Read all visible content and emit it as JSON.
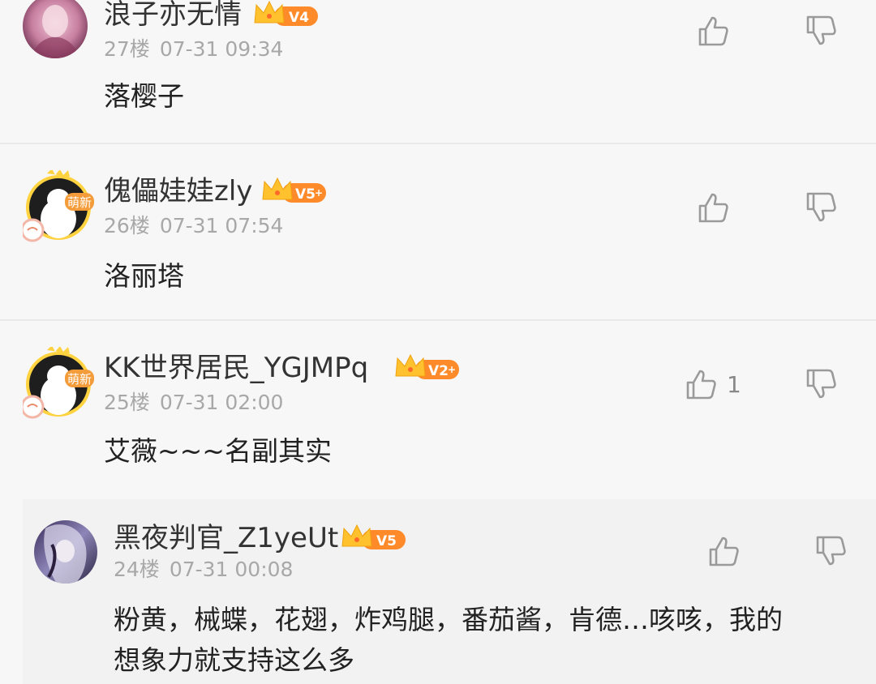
{
  "comments": [
    {
      "username": "浪子亦无情",
      "level": "V4",
      "floor": "27楼",
      "time": "07-31 09:34",
      "content": "落樱子",
      "likes": ""
    },
    {
      "username": "傀儡娃娃zly",
      "level": "V5",
      "avatar_tag": "萌新",
      "floor": "26楼",
      "time": "07-31 07:54",
      "content": "洛丽塔",
      "likes": ""
    },
    {
      "username": "KK世界居民_YGJMPq",
      "level": "V2",
      "avatar_tag": "萌新",
      "floor": "25楼",
      "time": "07-31 02:00",
      "content": "艾薇~~~名副其实",
      "likes": "1"
    },
    {
      "username": "黑夜判官_Z1yeUt",
      "level": "V5",
      "floor": "24楼",
      "time": "07-31 00:08",
      "content_line1": "粉黄，械蝶，花翅，炸鸡腿，番茄酱，肯德…咳咳，我的",
      "content_line2": "想象力就支持这么多",
      "likes": ""
    }
  ],
  "colors": {
    "badge_orange": "#ff8a2a",
    "crown_gold": "#ffc12e",
    "icon_gray": "#9a9a9a",
    "meta_gray": "#a8a8a8"
  }
}
